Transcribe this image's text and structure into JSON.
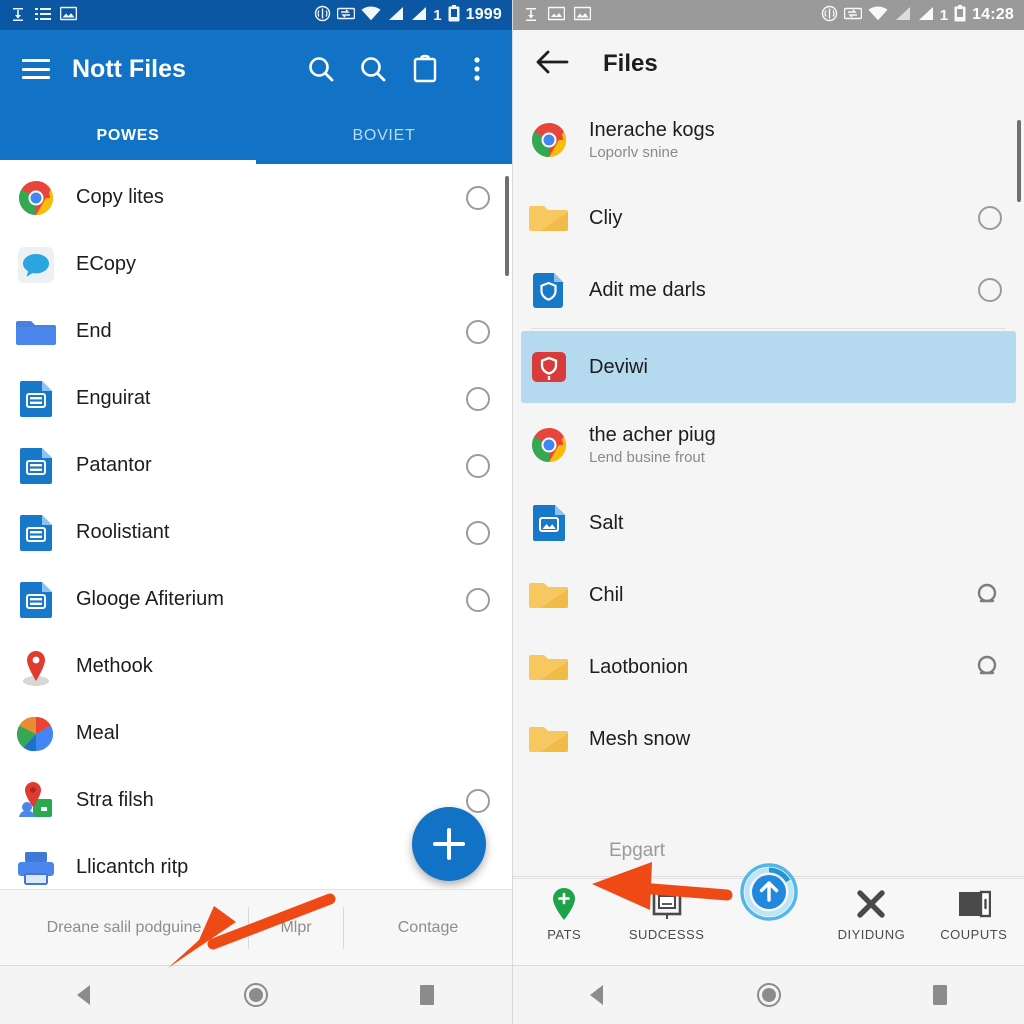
{
  "left": {
    "statusbar": {
      "icons": [
        "download-icon",
        "list-icon",
        "image-icon"
      ],
      "right_icons": [
        "vibrate-icon",
        "sync-icon",
        "wifi-icon",
        "signal-icon",
        "signal-icon"
      ],
      "sim_count": "1",
      "battery": "battery-icon",
      "time": "1999"
    },
    "appbar": {
      "menu_icon": "hamburger-icon",
      "title": "Nott Files",
      "actions": [
        "search-icon",
        "search-icon",
        "clipboard-icon",
        "overflow-menu-icon"
      ]
    },
    "tabs": [
      {
        "label": "POWES",
        "active": true
      },
      {
        "label": "BOVIET",
        "active": false
      }
    ],
    "items": [
      {
        "title": "Copy lites",
        "icon": "chrome-icon",
        "radio": true
      },
      {
        "title": "ECopy",
        "icon": "message-icon",
        "radio": false
      },
      {
        "title": "End",
        "icon": "folder-blue-icon",
        "radio": true
      },
      {
        "title": "Enguirat",
        "icon": "doc-blue-icon",
        "radio": true
      },
      {
        "title": "Patantor",
        "icon": "doc-blue-icon",
        "radio": true
      },
      {
        "title": "Roolistiant",
        "icon": "doc-blue-icon",
        "radio": true
      },
      {
        "title": "Glooge Afiterium",
        "icon": "doc-blue-icon",
        "radio": true
      },
      {
        "title": "Methook",
        "icon": "map-pin-icon",
        "radio": false
      },
      {
        "title": "Meal",
        "icon": "maps-icon",
        "radio": false
      },
      {
        "title": "Stra filsh",
        "icon": "map-person-icon",
        "radio": true
      },
      {
        "title": "Llicantch ritp",
        "icon": "printer-icon",
        "radio": false
      }
    ],
    "fab": {
      "icon": "plus-icon"
    },
    "bottom_bar": [
      "Dreane salil podguine",
      "Mlpr",
      "Contage"
    ],
    "navbar": [
      "back-icon",
      "home-icon",
      "recents-icon"
    ]
  },
  "right": {
    "statusbar": {
      "icons": [
        "download-icon",
        "image-icon",
        "image-icon"
      ],
      "right_icons": [
        "vibrate-icon",
        "sync-icon",
        "wifi-icon",
        "signal-icon",
        "signal-icon"
      ],
      "sim_count": "1",
      "battery": "battery-icon",
      "time": "14:28"
    },
    "appbar": {
      "back_icon": "arrow-left-icon",
      "title": "Files"
    },
    "items": [
      {
        "title": "Inerache kogs",
        "sub": "Loporlv snine",
        "icon": "chrome-icon",
        "trailing": "none",
        "selected": false
      },
      {
        "title": "Cliy",
        "sub": "",
        "icon": "folder-amber-icon",
        "trailing": "radio",
        "selected": false
      },
      {
        "title": "Adit me darls",
        "sub": "",
        "icon": "shield-doc-icon",
        "trailing": "radio",
        "selected": false
      },
      {
        "title": "Deviwi",
        "sub": "",
        "icon": "red-shield-icon",
        "trailing": "none",
        "selected": true
      },
      {
        "title": "the acher piug",
        "sub": "Lend busine frout",
        "icon": "chrome-icon",
        "trailing": "none",
        "selected": false
      },
      {
        "title": "Salt",
        "sub": "",
        "icon": "doc-image-icon",
        "trailing": "none",
        "selected": false
      },
      {
        "title": "Chil",
        "sub": "",
        "icon": "folder-amber-icon",
        "trailing": "loupe",
        "selected": false
      },
      {
        "title": "Laotbonion",
        "sub": "",
        "icon": "folder-amber-icon",
        "trailing": "loupe",
        "selected": false
      },
      {
        "title": "Mesh snow",
        "sub": "",
        "icon": "folder-amber-icon",
        "trailing": "none",
        "selected": false
      }
    ],
    "footer_text": "Epgart",
    "bottom_nav": [
      {
        "label": "PATS",
        "icon": "green-pin-plus-icon"
      },
      {
        "label": "SUDCESSS",
        "icon": "window-icon"
      },
      {
        "label": "",
        "icon": "upload-circle-icon"
      },
      {
        "label": "DIYIDUNG",
        "icon": "close-x-icon"
      },
      {
        "label": "COUPUTS",
        "icon": "wallet-icon"
      }
    ],
    "navbar": [
      "back-icon",
      "home-icon",
      "recents-icon"
    ]
  },
  "annotations": {
    "arrows": [
      {
        "name": "arrow-pointing-bottom-left",
        "color": "#ef4a16"
      },
      {
        "name": "arrow-pointing-left",
        "color": "#ef4a16"
      }
    ]
  },
  "colors": {
    "app_blue": "#1273c6",
    "status_blue": "#0b57a4",
    "status_grey": "#9a9a9a",
    "selection_blue": "#b5d9ef",
    "arrow_orange": "#ef4a16",
    "folder_amber": "#fcc952"
  }
}
